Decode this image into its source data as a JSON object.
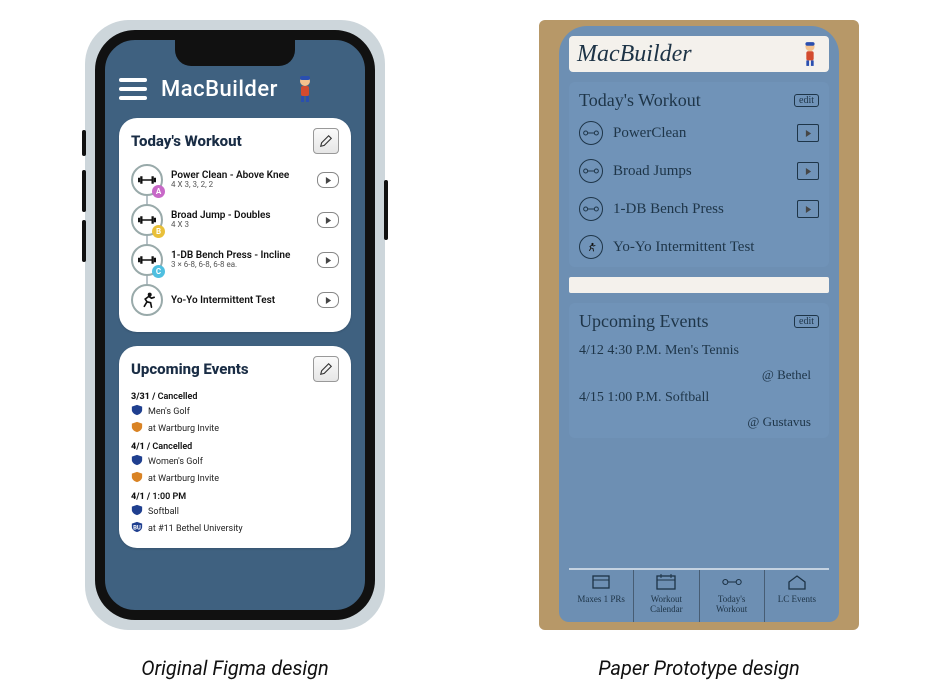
{
  "captions": {
    "left": "Original Figma design",
    "right": "Paper Prototype design"
  },
  "figma": {
    "appTitle": "MacBuilder",
    "workoutCard": {
      "title": "Today's Workout",
      "items": [
        {
          "name": "Power Clean - Above Knee",
          "sets": "4 X 3, 3, 2, 2",
          "badge": "A",
          "badgeColor": "#c869c8",
          "icon": "barbell"
        },
        {
          "name": "Broad Jump - Doubles",
          "sets": "4 X 3",
          "badge": "B",
          "badgeColor": "#e9c03a",
          "icon": "barbell"
        },
        {
          "name": "1-DB Bench Press - Incline",
          "sets": "3 × 6-8, 6-8, 6-8 ea.",
          "badge": "C",
          "badgeColor": "#4fbfe0",
          "icon": "barbell"
        },
        {
          "name": "Yo-Yo Intermittent Test",
          "sets": "",
          "badge": "",
          "badgeColor": "",
          "icon": "runner"
        }
      ]
    },
    "eventsCard": {
      "title": "Upcoming Events",
      "groups": [
        {
          "date": "3/31",
          "status": "Cancelled",
          "lines": [
            {
              "icon": "shield-blue",
              "text": "Men's Golf"
            },
            {
              "icon": "shield-orange",
              "text": "at Wartburg Invite"
            }
          ]
        },
        {
          "date": "4/1",
          "status": "Cancelled",
          "lines": [
            {
              "icon": "shield-blue",
              "text": "Women's Golf"
            },
            {
              "icon": "shield-orange",
              "text": "at Wartburg Invite"
            }
          ]
        },
        {
          "date": "4/1",
          "status": "1:00 PM",
          "lines": [
            {
              "icon": "shield-blue",
              "text": "Softball"
            },
            {
              "icon": "shield-bu",
              "text": "at #11 Bethel University"
            }
          ]
        }
      ]
    }
  },
  "paper": {
    "appTitle": "MacBuilder",
    "workoutCard": {
      "title": "Today's Workout",
      "editLabel": "edit",
      "items": [
        {
          "name": "PowerClean",
          "hasPlay": true,
          "icon": "barbell"
        },
        {
          "name": "Broad Jumps",
          "hasPlay": true,
          "icon": "barbell"
        },
        {
          "name": "1-DB Bench Press",
          "hasPlay": true,
          "icon": "barbell"
        },
        {
          "name": "Yo-Yo  Intermittent Test",
          "hasPlay": false,
          "icon": "runner"
        }
      ]
    },
    "eventsCard": {
      "title": "Upcoming Events",
      "editLabel": "edit",
      "events": [
        {
          "line1": "4/12  4:30 P.M.  Men's Tennis",
          "line2": "@ Bethel"
        },
        {
          "line1": "4/15  1:00 P.M.  Softball",
          "line2": "@ Gustavus"
        }
      ]
    },
    "tabs": [
      {
        "label": "Maxes 1 PRs",
        "icon": "box"
      },
      {
        "label": "Workout Calendar",
        "icon": "calendar"
      },
      {
        "label": "Today's Workout",
        "icon": "barbell"
      },
      {
        "label": "LC Events",
        "icon": "home"
      }
    ]
  }
}
